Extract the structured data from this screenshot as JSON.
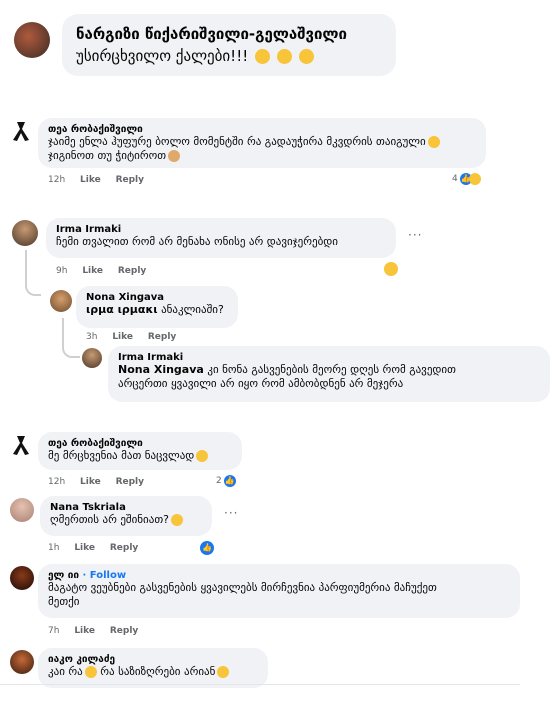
{
  "post": {
    "title_line1": "ნარგიზი წიქარიშვილი-გელაშვილი",
    "title_line2": "უსირცხვილო ქალები!!!"
  },
  "comments": [
    {
      "author": "თეა რობაქიშვილი",
      "line1": "ჯაიმე ენლა ჰუფურე ბოლო მომენტში რა გადაუჭირა მკვდრის თაიგული",
      "line2": "ჯიგინოთ თუ ჭიტიროთ",
      "time": "12h",
      "like": "Like",
      "reply": "Reply",
      "reactions": "4"
    },
    {
      "author": "Irma Irmaki",
      "line1": "ჩემი თვალით რომ არ მენახა ონისე არ დავიჯერებდი",
      "time": "9h",
      "like": "Like",
      "reply": "Reply"
    },
    {
      "author": "Nona Xingava",
      "mention": "ιρμα ιρμακι",
      "line1": "ანაკლიაში?",
      "time": "3h",
      "like": "Like",
      "reply": "Reply"
    },
    {
      "author": "Irma Irmaki",
      "mention": "Nona Xingava",
      "line1": "კი ნონა გასვენების მეორე დღეს რომ გავედით",
      "line2": "არცერთი ყვავილი არ იყო რომ ამბობდნენ არ მეჯერა"
    },
    {
      "author": "თეა რობაქიშვილი",
      "line1": "მე მრცხვენია მათ ნაცვლად",
      "time": "12h",
      "like": "Like",
      "reply": "Reply",
      "reactions": "2"
    },
    {
      "author": "Nana Tskriala",
      "line1": "ღმერთის არ ეშინიათ?",
      "time": "1h",
      "like": "Like",
      "reply": "Reply"
    },
    {
      "author": "ელ იი",
      "follow": "· Follow",
      "line1": "მაგატო ვეუბნები გასვენების ყვავილებს მირჩევნია პარფიუმერია მაჩუქეთ",
      "line2": "მეთქი",
      "time": "7h",
      "like": "Like",
      "reply": "Reply"
    },
    {
      "author": "იაკო კილაძე",
      "line1": "კაი რა",
      "line2": "რა საზიზღრები არიან"
    }
  ],
  "icons": {
    "like": "thumbs-up-icon",
    "haha": "laughing-face-icon",
    "sad": "sad-face-icon",
    "more": "more-options-icon"
  },
  "colors": {
    "accent": "#1877f2",
    "bubble": "#f0f2f5",
    "meta": "#65676b"
  }
}
